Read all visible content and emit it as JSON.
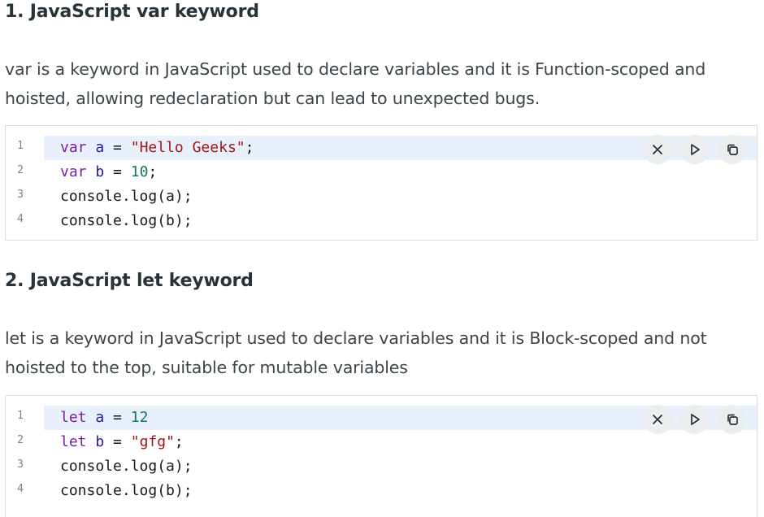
{
  "sections": [
    {
      "heading": "1. JavaScript var keyword",
      "description": "var is a keyword in JavaScript used to declare variables and it is Function-scoped and hoisted, allowing redeclaration but can lead to unexpected bugs.",
      "lines": [
        {
          "num": "1",
          "tokens": [
            "var",
            "a",
            "=",
            "\"Hello Geeks\"",
            ";"
          ]
        },
        {
          "num": "2",
          "tokens": [
            "var",
            "b",
            "=",
            "10",
            ";"
          ]
        },
        {
          "num": "3",
          "text": "console.log(a);"
        },
        {
          "num": "4",
          "text": "console.log(b);"
        }
      ]
    },
    {
      "heading": "2. JavaScript let keyword",
      "description": "let is a keyword in JavaScript used to declare variables and it is Block-scoped and not hoisted to the top, suitable for mutable variables",
      "lines": [
        {
          "num": "1",
          "tokens": [
            "let",
            "a",
            "=",
            "12"
          ]
        },
        {
          "num": "2",
          "tokens": [
            "let",
            "b",
            "=",
            "\"gfg\"",
            ";"
          ]
        },
        {
          "num": "3",
          "text": "console.log(a);"
        },
        {
          "num": "4",
          "text": "console.log(b);"
        }
      ]
    }
  ],
  "icons": {
    "clear": "close-icon",
    "run": "play-icon",
    "copy": "copy-icon"
  },
  "colors": {
    "keyword": "#7b1fa2",
    "variable": "#1d1aab",
    "string": "#a31515",
    "number": "#11775a",
    "active_line": "#e8f0fb",
    "button_bg": "#ebeeef"
  }
}
